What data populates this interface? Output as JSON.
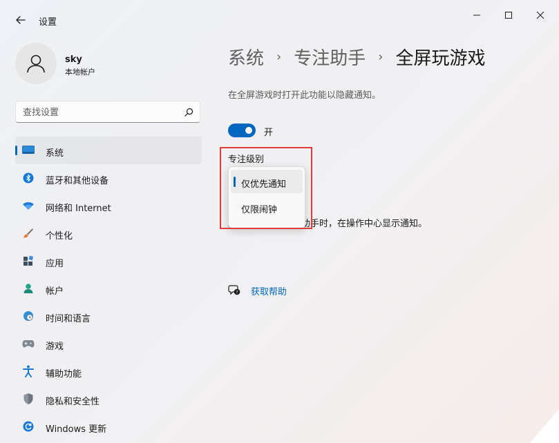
{
  "window": {
    "title": "设置"
  },
  "account": {
    "name": "sky",
    "type": "本地帐户"
  },
  "search": {
    "placeholder": "查找设置"
  },
  "sidebar": {
    "items": [
      {
        "label": "系统",
        "icon": "system-display-icon",
        "active": true
      },
      {
        "label": "蓝牙和其他设备",
        "icon": "bluetooth-icon",
        "active": false
      },
      {
        "label": "网络和 Internet",
        "icon": "wifi-icon",
        "active": false
      },
      {
        "label": "个性化",
        "icon": "brush-icon",
        "active": false
      },
      {
        "label": "应用",
        "icon": "apps-icon",
        "active": false
      },
      {
        "label": "帐户",
        "icon": "account-icon",
        "active": false
      },
      {
        "label": "时间和语言",
        "icon": "globe-clock-icon",
        "active": false
      },
      {
        "label": "游戏",
        "icon": "gamepad-icon",
        "active": false
      },
      {
        "label": "辅助功能",
        "icon": "accessibility-icon",
        "active": false
      },
      {
        "label": "隐私和安全性",
        "icon": "shield-icon",
        "active": false
      },
      {
        "label": "Windows 更新",
        "icon": "windows-update-icon",
        "active": false
      }
    ]
  },
  "breadcrumb": {
    "items": [
      "系统",
      "专注助手"
    ],
    "separator": "›",
    "current": "全屏玩游戏"
  },
  "main": {
    "description": "在全屏游戏时打开此功能以隐藏通知。",
    "toggle_label": "开",
    "toggle_on": true,
    "focus_level_label": "专注级别",
    "focus_options": [
      "仅优先通知",
      "仅限闹钟"
    ],
    "focus_selected": "仅优先通知",
    "partially_hidden_text": "当自动打开专注助手时，在操作中心显示通知。",
    "visible_tail_text": "启动打开专注助手时，在操作中心显示通知。",
    "help_link": "获取帮助"
  },
  "colors": {
    "accent": "#0067c0",
    "highlight_border": "#e23a3a"
  }
}
